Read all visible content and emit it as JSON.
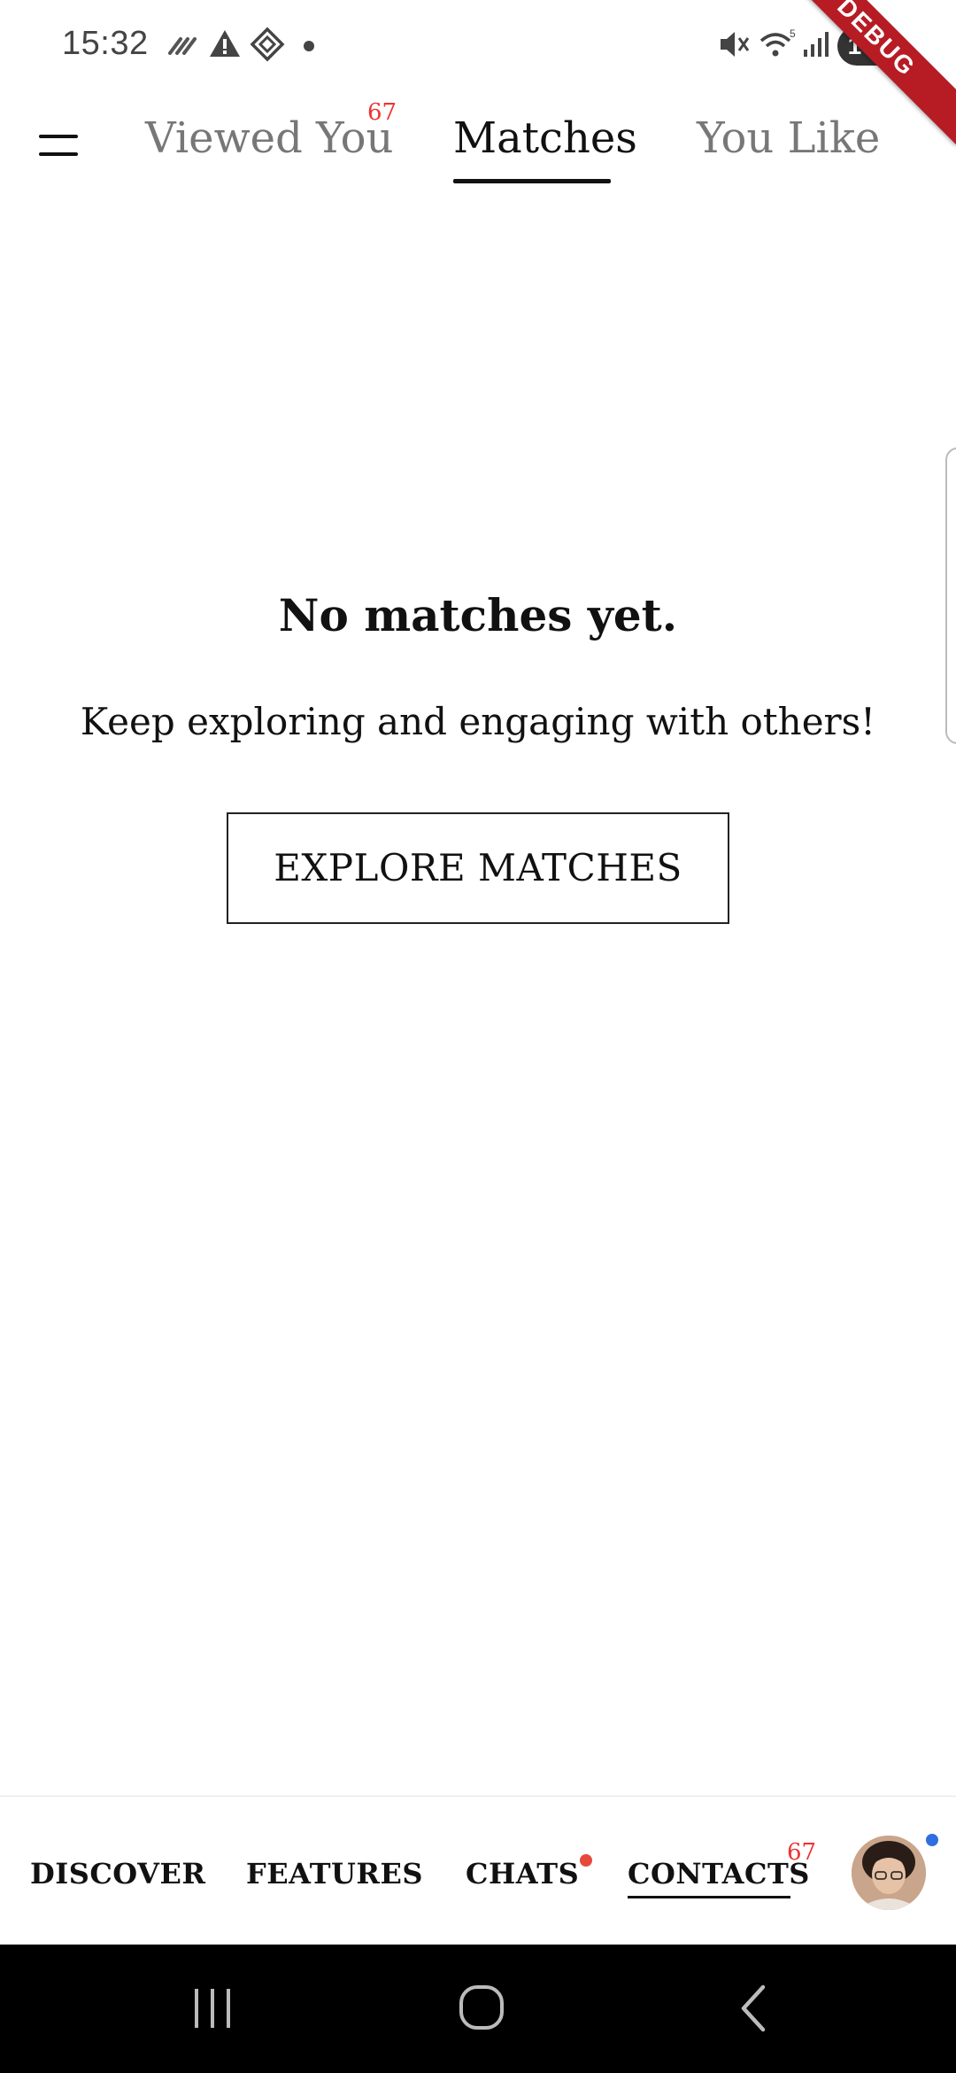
{
  "status_bar": {
    "time": "15:32",
    "battery": "100"
  },
  "debug_ribbon": "DEBUG",
  "top_tabs": {
    "items": [
      {
        "label": "Viewed You",
        "badge": "67",
        "active": false
      },
      {
        "label": "Matches",
        "active": true
      },
      {
        "label": "You Like",
        "active": false
      }
    ]
  },
  "empty_state": {
    "title": "No matches yet.",
    "subtitle": "Keep exploring and engaging with others!",
    "button_label": "EXPLORE MATCHES"
  },
  "bottom_nav": {
    "items": [
      {
        "label": "DISCOVER"
      },
      {
        "label": "FEATURES"
      },
      {
        "label": "CHATS",
        "has_dot": true
      },
      {
        "label": "CONTACTS",
        "badge": "67",
        "active": true
      }
    ]
  },
  "colors": {
    "badge_red": "#e33333",
    "chats_dot": "#e64a3c",
    "avatar_dot": "#2f6fe0",
    "debug_ribbon": "#b71c24"
  },
  "icons": {
    "status_left": [
      "data-saver-icon",
      "warning-icon",
      "app-diamond-icon",
      "notification-dot"
    ],
    "status_right": [
      "mute-icon",
      "wifi-icon",
      "signal-icon",
      "battery-icon"
    ],
    "system_nav": [
      "recent-apps-icon",
      "home-icon",
      "back-icon"
    ]
  }
}
